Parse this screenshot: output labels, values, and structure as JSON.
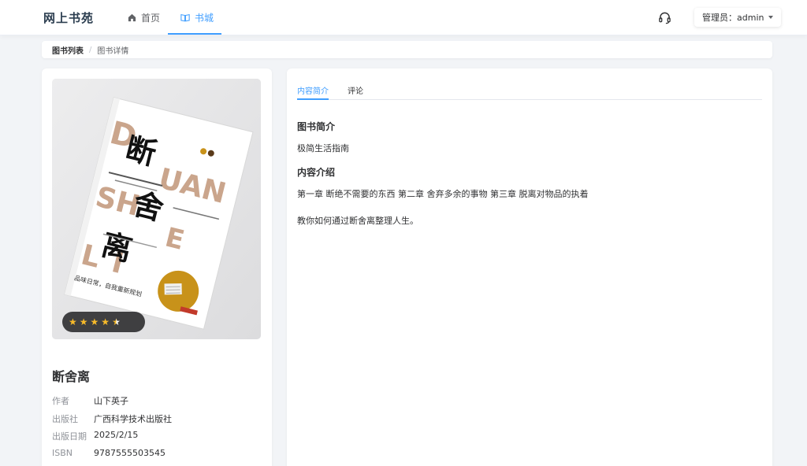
{
  "header": {
    "logo": "网上书苑",
    "nav": [
      {
        "label": "首页",
        "icon": "home-icon"
      },
      {
        "label": "书城",
        "icon": "book-icon"
      }
    ],
    "support_icon": "headset-icon",
    "user_label": "管理员：admin"
  },
  "breadcrumb": [
    "图书列表",
    "图书详情"
  ],
  "book": {
    "title": "断舍离",
    "rating": 4.5,
    "rating_max": 5,
    "meta": [
      {
        "key": "作者",
        "value": "山下英子"
      },
      {
        "key": "出版社",
        "value": "广西科学技术出版社"
      },
      {
        "key": "出版日期",
        "value": "2025/2/15"
      },
      {
        "key": "ISBN",
        "value": "9787555503545"
      }
    ],
    "cover": {
      "chars": [
        "断",
        "舍",
        "离"
      ],
      "latin": [
        "D",
        "UAN",
        "SH",
        "E",
        "L",
        "I"
      ],
      "slogan": "品味日常，自我重新规划",
      "emblem_color": "#c8921a"
    }
  },
  "tabs": [
    {
      "label": "内容简介",
      "active": true
    },
    {
      "label": "评论",
      "active": false
    }
  ],
  "content": {
    "intro_heading": "图书简介",
    "intro_text": "极简生活指南",
    "detail_heading": "内容介绍",
    "detail_line1": "第一章 断绝不需要的东西 第二章 舍弃多余的事物 第三章 脱离对物品的执着",
    "detail_line2": "教你如何通过断舍离整理人生。"
  },
  "colors": {
    "accent": "#409eff",
    "background": "#f2f4f7",
    "star": "#f7ba2a"
  }
}
